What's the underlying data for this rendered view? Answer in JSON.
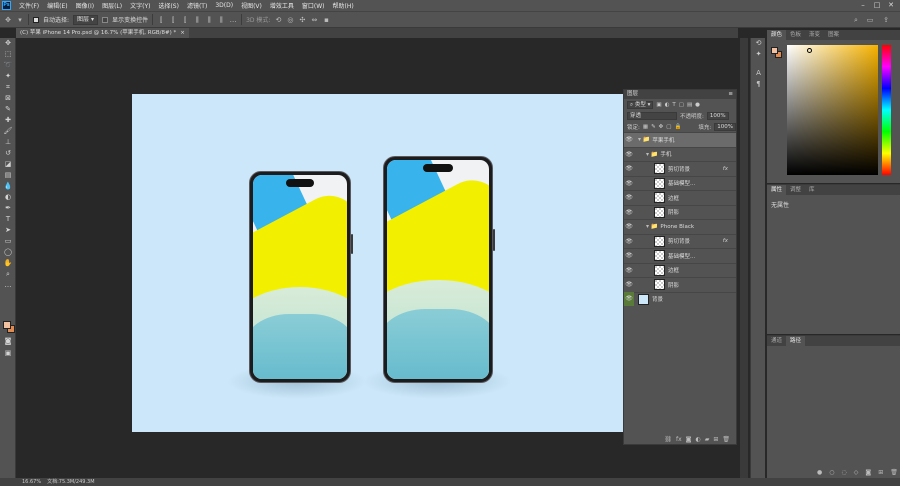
{
  "menubar": {
    "logo": "Ps",
    "items": [
      "文件(F)",
      "编辑(E)",
      "图像(I)",
      "图层(L)",
      "文字(Y)",
      "选择(S)",
      "滤镜(T)",
      "3D(D)",
      "视图(V)",
      "增效工具",
      "窗口(W)",
      "帮助(H)"
    ]
  },
  "options": {
    "auto_select_label": "自动选择:",
    "auto_select_value": "图层",
    "transform_label": "显示变换控件",
    "mode_3d": "3D 模式:"
  },
  "document": {
    "tab_title": "(C) 苹果 iPhone 14 Pro.psd @ 16.7% (苹果手机, RGB/8#) *",
    "close": "×"
  },
  "layers_panel": {
    "title": "图层",
    "filter_label": "类型",
    "blend_mode": "穿透",
    "opacity_label": "不透明度:",
    "opacity_value": "100%",
    "lock_label": "锁定:",
    "fill_label": "填充:",
    "fill_value": "100%",
    "layers": [
      {
        "name": "苹果手机",
        "kind": "group",
        "indent": 0,
        "expanded": true,
        "selected": true
      },
      {
        "name": "手机",
        "kind": "group",
        "indent": 1,
        "expanded": true
      },
      {
        "name": "剪切背景",
        "kind": "smart",
        "indent": 2,
        "fx": "fx"
      },
      {
        "name": "基础模型...",
        "kind": "smart",
        "indent": 2
      },
      {
        "name": "边框",
        "kind": "layer",
        "indent": 2
      },
      {
        "name": "阴影",
        "kind": "layer",
        "indent": 2
      },
      {
        "name": "Phone Black",
        "kind": "group",
        "indent": 1,
        "expanded": true
      },
      {
        "name": "剪切背景",
        "kind": "smart",
        "indent": 2,
        "fx": "fx"
      },
      {
        "name": "基础模型...",
        "kind": "smart",
        "indent": 2
      },
      {
        "name": "边框",
        "kind": "layer",
        "indent": 2
      },
      {
        "name": "阴影",
        "kind": "layer",
        "indent": 2
      },
      {
        "name": "背景",
        "kind": "background",
        "indent": 0
      }
    ]
  },
  "color_panel": {
    "tabs": [
      "颜色",
      "色板",
      "渐变",
      "图案"
    ],
    "fg_color": "#f2c1a2",
    "bg_color": "#e08b52"
  },
  "properties_panel": {
    "tabs": [
      "属性",
      "调整",
      "库"
    ],
    "content": "无属性"
  },
  "paths_panel": {
    "tabs": [
      "通道",
      "路径"
    ]
  },
  "status": {
    "zoom": "16.67%",
    "doc_info": "文档:75.3M/249.3M"
  }
}
